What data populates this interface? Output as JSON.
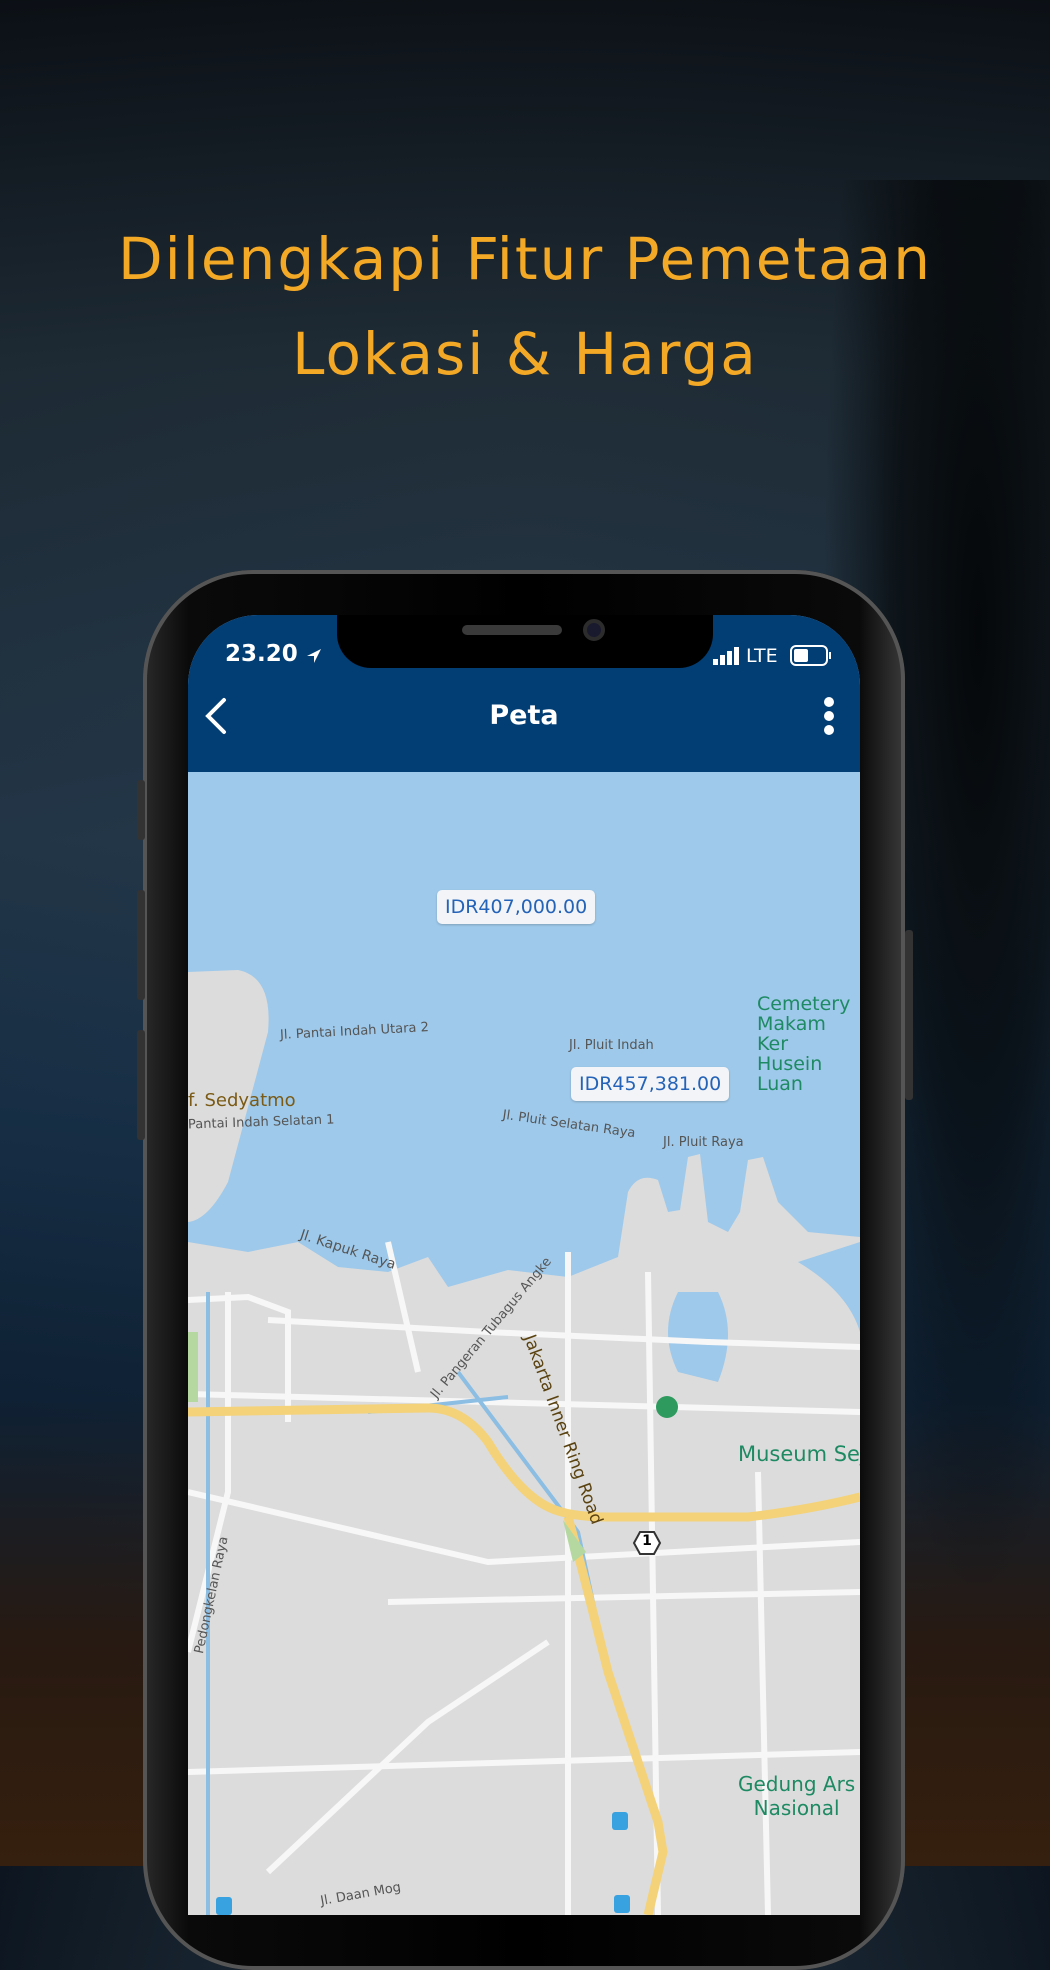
{
  "headline": {
    "line1": "Dilengkapi Fitur Pemetaan",
    "line2": "Lokasi & Harga"
  },
  "status_bar": {
    "time": "23.20",
    "network": "LTE",
    "icons": [
      "location-arrow-icon",
      "signal-icon",
      "battery-icon"
    ]
  },
  "nav": {
    "title": "Peta",
    "back_icon": "chevron-left-icon",
    "menu_icon": "more-vertical-icon"
  },
  "map": {
    "price_markers": [
      {
        "label": "IDR407,000.00"
      },
      {
        "label": "IDR457,381.00"
      }
    ],
    "labels": {
      "cemetery1": "Cemetery",
      "cemetery2": "Makam Ker",
      "cemetery3": "Husein Luan",
      "pantai_utara": "Jl. Pantai Indah Utara 2",
      "pluit_indah": "Jl. Pluit Indah",
      "sedyatmo": "f. Sedyatmo",
      "pantai_selatan": "Pantai Indah Selatan 1",
      "pluit_selatan": "Jl. Pluit Selatan Raya",
      "pluit_raya": "Jl. Pluit Raya",
      "museum": "Museum Sejarah Jak",
      "ring_road": "Jakarta Inner Ring Road",
      "kapuk": "Jl. Kapuk Raya",
      "tubagus": "Jl. Pangeran Tubagus Angke",
      "pedongkelan": "Pedongkelan Raya",
      "gedung1": "Gedung Ars",
      "gedung2": "Nasional",
      "daan": "Jl. Daan Mog",
      "route_shield": "1"
    },
    "colors": {
      "water": "#9ec9ea",
      "land": "#dcdcdc",
      "road": "#f7f7f7",
      "highway": "#f3d27a",
      "poi": "#1e8a63",
      "marker_text": "#2563b8"
    }
  },
  "colors": {
    "headline": "#f3a826",
    "nav_bg": "#023d74"
  }
}
